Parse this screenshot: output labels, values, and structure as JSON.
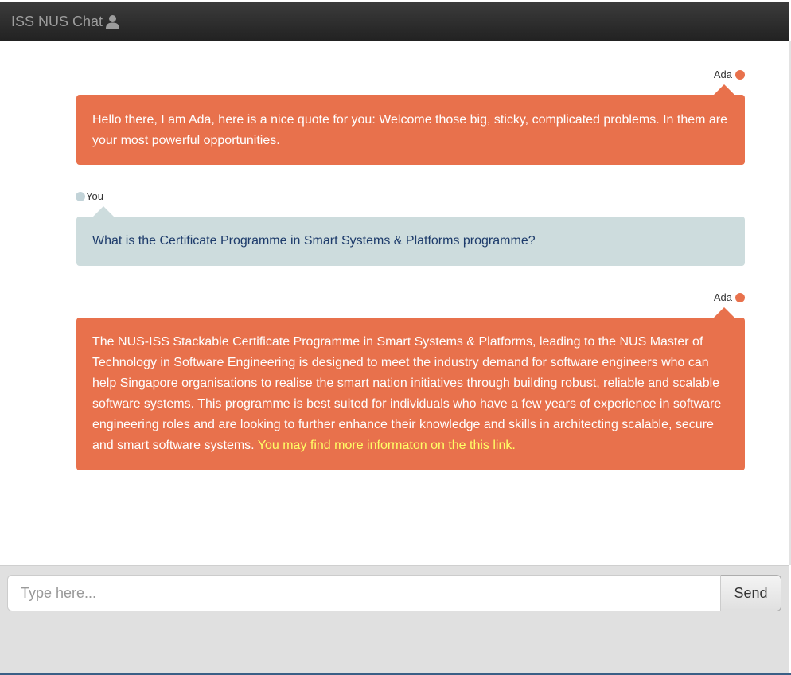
{
  "navbar": {
    "brand": "ISS NUS Chat",
    "icon": "user-icon"
  },
  "messages": [
    {
      "sender": "Ada",
      "text": "Hello there, I am Ada, here is a nice quote for you: Welcome those big, sticky, complicated problems. In them are your most powerful opportunities."
    },
    {
      "sender": "You",
      "text": "What is the Certificate Programme in Smart Systems & Platforms programme?"
    },
    {
      "sender": "Ada",
      "text": "The NUS-ISS Stackable Certificate Programme in Smart Systems & Platforms, leading to the NUS Master of Technology in Software Engineering is designed to meet the industry demand for software engineers who can help Singapore organisations to realise the smart nation initiatives through building robust, reliable and scalable software systems. This programme is best suited for individuals who have a few years of experience in software engineering roles and are looking to further enhance their knowledge and skills in architecting scalable, secure and smart software systems.",
      "link_text": "You may find more informaton on the this link."
    }
  ],
  "composer": {
    "placeholder": "Type here...",
    "send_label": "Send"
  },
  "colors": {
    "ada_bubble": "#e8714c",
    "user_bubble": "#cddcdd",
    "user_text": "#1d3b6b",
    "link": "#ffff66"
  }
}
